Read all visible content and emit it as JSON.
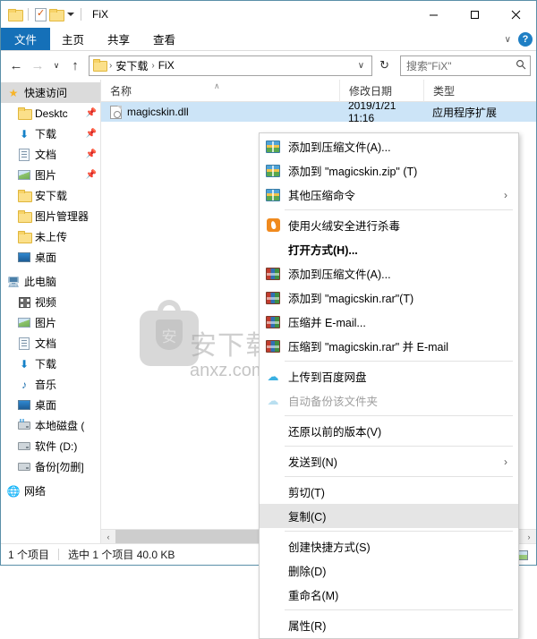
{
  "window": {
    "title": "FiX",
    "quick_access_toolbar": [
      {
        "name": "folder-icon",
        "label": ""
      },
      {
        "name": "properties-icon",
        "label": ""
      },
      {
        "name": "new-folder-icon",
        "label": ""
      },
      {
        "name": "customize-caret-icon",
        "label": ""
      }
    ],
    "controls": {
      "minimize": "─",
      "maximize": "□",
      "close": "✕"
    }
  },
  "ribbon": {
    "tabs": [
      {
        "label": "文件",
        "active": true
      },
      {
        "label": "主页",
        "active": false
      },
      {
        "label": "共享",
        "active": false
      },
      {
        "label": "查看",
        "active": false
      }
    ],
    "collapse_label": "∨",
    "help_label": "?"
  },
  "address": {
    "back": "←",
    "forward": "→",
    "recent": "∨",
    "up": "↑",
    "crumbs": [
      "安下载",
      "FiX"
    ],
    "crumb_sep": "›",
    "dropdown": "∨",
    "refresh": "↻"
  },
  "search": {
    "placeholder": "搜索\"FiX\"",
    "icon": "⌕"
  },
  "sidebar": {
    "groups": [
      {
        "header": {
          "label": "快速访问",
          "icon": "star-icon",
          "selected": true
        },
        "items": [
          {
            "label": "Desktc",
            "icon": "folder-icon",
            "pinned": true
          },
          {
            "label": "下载",
            "icon": "download-icon",
            "pinned": true
          },
          {
            "label": "文档",
            "icon": "document-icon",
            "pinned": true
          },
          {
            "label": "图片",
            "icon": "pictures-icon",
            "pinned": true
          },
          {
            "label": "安下载",
            "icon": "folder-icon",
            "pinned": false
          },
          {
            "label": "图片管理器",
            "icon": "folder-icon",
            "pinned": false
          },
          {
            "label": "未上传",
            "icon": "folder-icon",
            "pinned": false
          },
          {
            "label": "桌面",
            "icon": "desktop-icon",
            "pinned": false
          }
        ]
      },
      {
        "header": {
          "label": "此电脑",
          "icon": "this-pc-icon",
          "selected": false
        },
        "items": [
          {
            "label": "视频",
            "icon": "videos-icon",
            "pinned": false
          },
          {
            "label": "图片",
            "icon": "pictures-icon",
            "pinned": false
          },
          {
            "label": "文档",
            "icon": "document-icon",
            "pinned": false
          },
          {
            "label": "下载",
            "icon": "download-icon",
            "pinned": false
          },
          {
            "label": "音乐",
            "icon": "music-icon",
            "pinned": false
          },
          {
            "label": "桌面",
            "icon": "desktop-icon",
            "pinned": false
          },
          {
            "label": "本地磁盘 (",
            "icon": "system-drive-icon",
            "pinned": false
          },
          {
            "label": "软件 (D:)",
            "icon": "drive-icon",
            "pinned": false
          },
          {
            "label": "备份[勿删]",
            "icon": "drive-icon",
            "pinned": false
          }
        ]
      },
      {
        "header": {
          "label": "网络",
          "icon": "network-icon",
          "selected": false
        },
        "items": []
      }
    ]
  },
  "filelist": {
    "columns": [
      {
        "label": "名称",
        "sorted": true,
        "sort_caret": "∧"
      },
      {
        "label": "修改日期",
        "sorted": false,
        "sort_caret": ""
      },
      {
        "label": "类型",
        "sorted": false,
        "sort_caret": ""
      }
    ],
    "rows": [
      {
        "name": "magicskin.dll",
        "date": "2019/1/21 11:16",
        "type": "应用程序扩展",
        "icon": "dll-file-icon",
        "selected": true
      }
    ],
    "hscroll": {
      "left_arrow": "‹",
      "right_arrow": "›"
    }
  },
  "watermark": {
    "glyph": "安",
    "text": "安下载",
    "site": "anxz.com"
  },
  "context_menu": {
    "items": [
      {
        "label": "添加到压缩文件(A)...",
        "icon": "zip-icon",
        "type": "item"
      },
      {
        "label": "添加到 \"magicskin.zip\" (T)",
        "icon": "zip-icon",
        "type": "item"
      },
      {
        "label": "其他压缩命令",
        "icon": "zip-icon",
        "type": "submenu",
        "arrow": "›"
      },
      {
        "type": "separator"
      },
      {
        "label": "使用火绒安全进行杀毒",
        "icon": "huorong-icon",
        "type": "item"
      },
      {
        "label": "打开方式(H)...",
        "icon": "",
        "type": "item",
        "bold": true
      },
      {
        "label": "添加到压缩文件(A)...",
        "icon": "rar-icon",
        "type": "item"
      },
      {
        "label": "添加到 \"magicskin.rar\"(T)",
        "icon": "rar-icon",
        "type": "item"
      },
      {
        "label": "压缩并 E-mail...",
        "icon": "rar-icon",
        "type": "item"
      },
      {
        "label": "压缩到 \"magicskin.rar\" 并 E-mail",
        "icon": "rar-icon",
        "type": "item"
      },
      {
        "type": "separator"
      },
      {
        "label": "上传到百度网盘",
        "icon": "baidu-icon",
        "type": "item"
      },
      {
        "label": "自动备份该文件夹",
        "icon": "baidu-icon-dim",
        "type": "item",
        "disabled": true
      },
      {
        "type": "separator"
      },
      {
        "label": "还原以前的版本(V)",
        "icon": "",
        "type": "item"
      },
      {
        "type": "separator"
      },
      {
        "label": "发送到(N)",
        "icon": "",
        "type": "submenu",
        "arrow": "›"
      },
      {
        "type": "separator"
      },
      {
        "label": "剪切(T)",
        "icon": "",
        "type": "item"
      },
      {
        "label": "复制(C)",
        "icon": "",
        "type": "item",
        "highlighted": true
      },
      {
        "type": "separator"
      },
      {
        "label": "创建快捷方式(S)",
        "icon": "",
        "type": "item"
      },
      {
        "label": "删除(D)",
        "icon": "",
        "type": "item"
      },
      {
        "label": "重命名(M)",
        "icon": "",
        "type": "item"
      },
      {
        "type": "separator"
      },
      {
        "label": "属性(R)",
        "icon": "",
        "type": "item"
      }
    ]
  },
  "statusbar": {
    "item_count": "1 个项目",
    "selection": "选中 1 个项目  40.0 KB",
    "view_details": "details-view-icon",
    "view_tiles": "tiles-view-icon"
  }
}
